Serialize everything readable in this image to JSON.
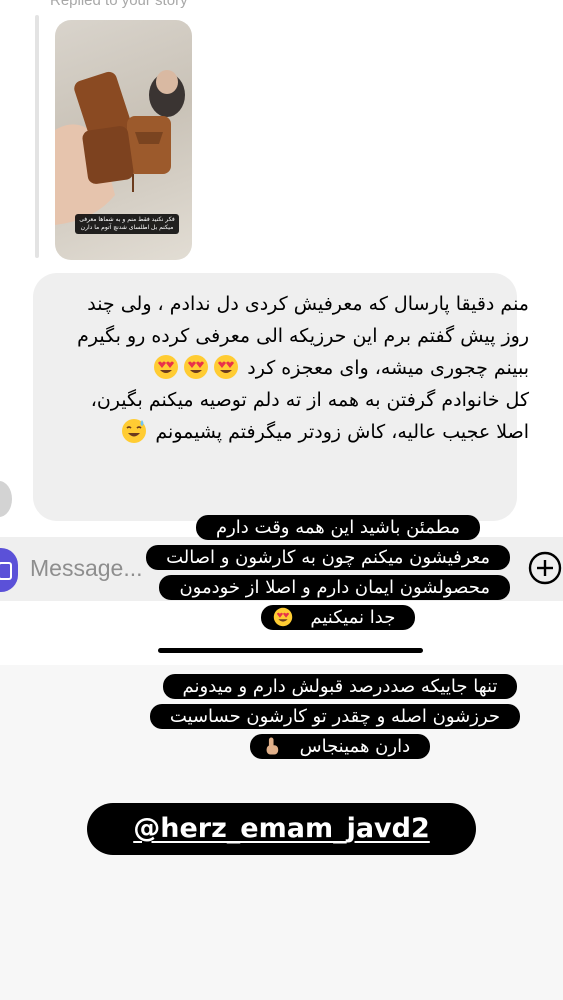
{
  "header": {
    "replied_label": "Replied to your story"
  },
  "story_reply": {
    "thumbnail_caption": "فکر نکنید فقط منم و به شماها معرفی میکنم بل اطلسای شدنچ آتوم ما دارن"
  },
  "message": {
    "paragraph_1": "منم دقیقا پارسال که معرفیش کردی دل ندادم ، ولی چند روز پیش گفتم برم این حرزیکه الی معرفی کرده رو بگیرم ببینم چجوری میشه، وای معجزه کرد",
    "paragraph_2": "کل خانوادم گرفتن به همه از ته دلم توصیه میکنم بگیرن، اصلا عجیب عالیه، کاش زودتر میگرفتم پشیمونم"
  },
  "composer": {
    "placeholder": "Message..."
  },
  "overlays": {
    "text_1": "مطمئن باشید این همه وقت دارم معرفیشون میکنم چون به کارشون و اصالت محصولشون ایمان دارم و اصلا از خودمون جدا نمیکنیم",
    "text_2": "تنها جاییکه صددرصد قبولش دارم و میدونم حرزشون اصله و چقدر تو کارشون حساسیت دارن همینجاس",
    "handle": "@herz_emam_javd2"
  },
  "colors": {
    "bubble": "#efefef",
    "camera_accent": "#5b51d8",
    "overlay_bg": "#000000",
    "bottom_bg": "#f7f7f7"
  },
  "icons": [
    "heart-eyes-emoji",
    "sweat-smile-emoji",
    "pointing-down-emoji",
    "camera-icon",
    "plus-circle-icon"
  ]
}
